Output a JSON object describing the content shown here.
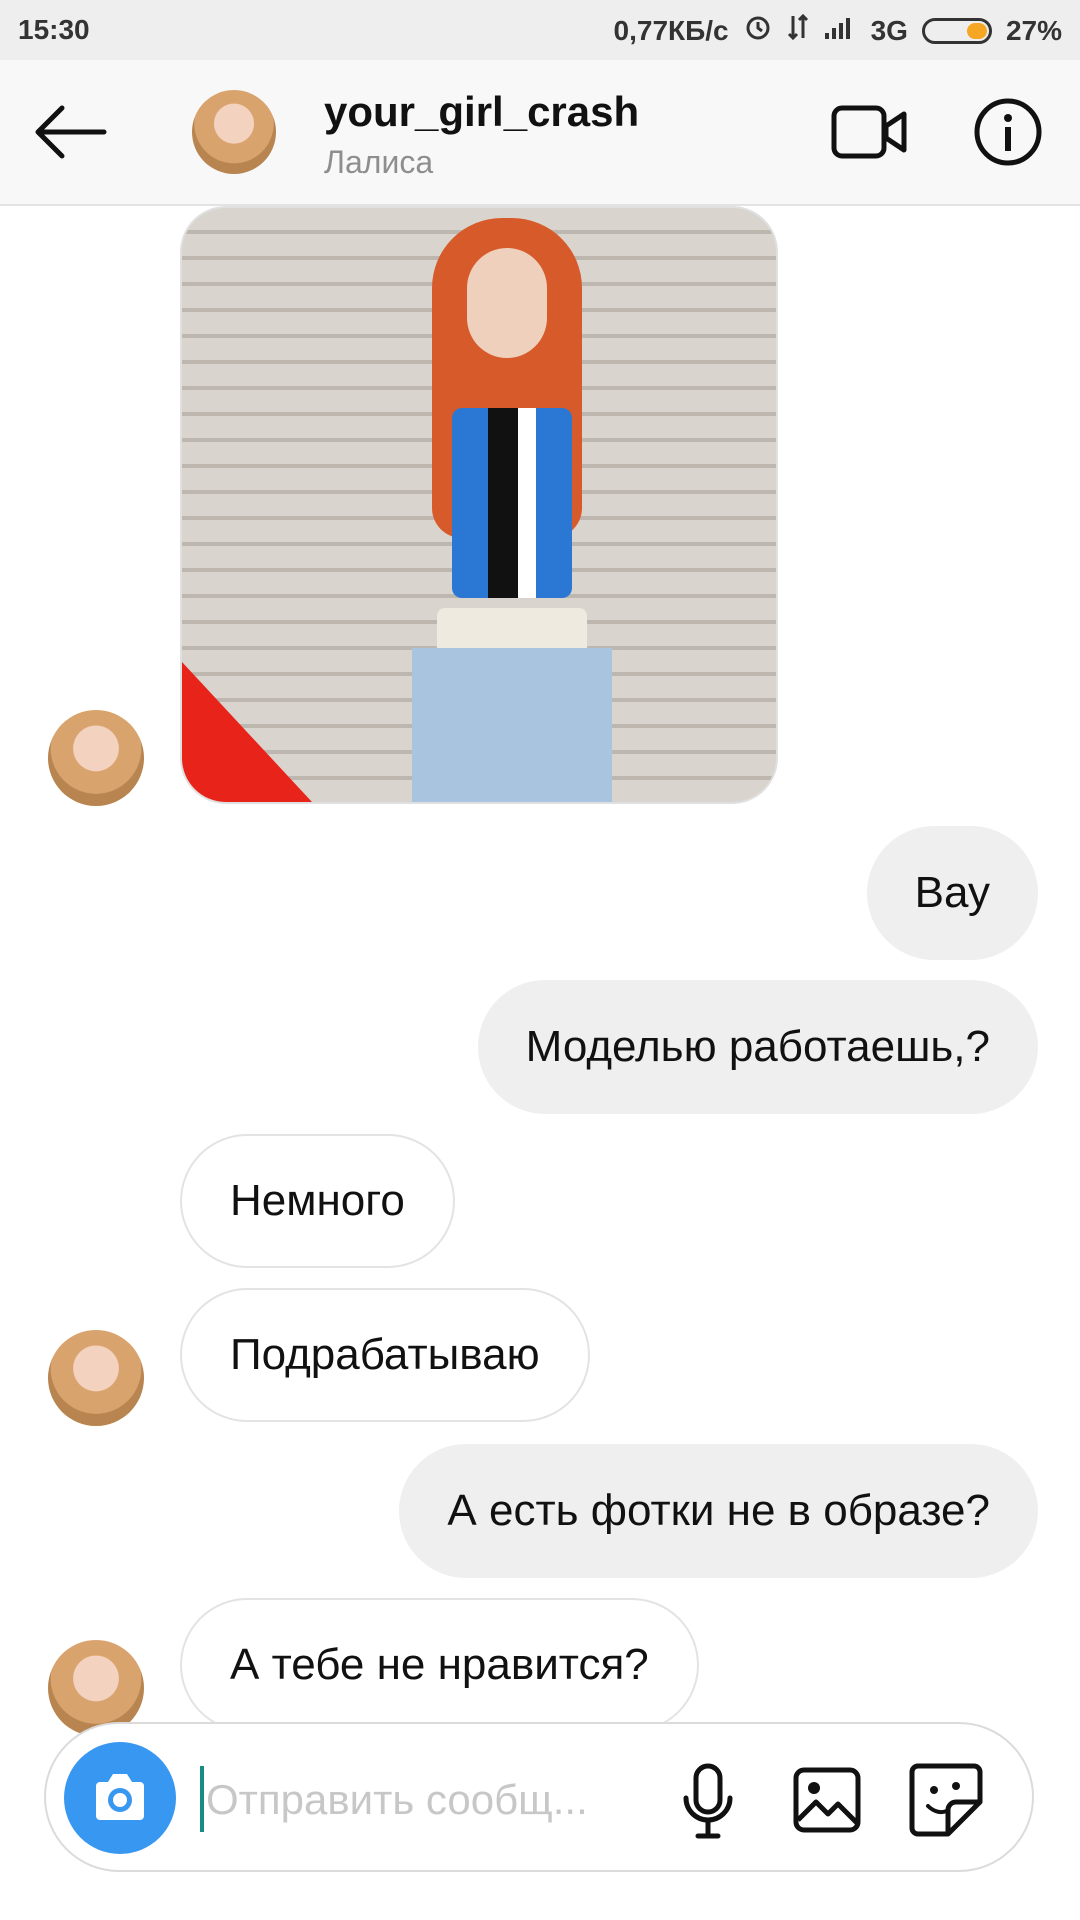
{
  "status_bar": {
    "time": "15:30",
    "speed": "0,77КБ/с",
    "network": "3G",
    "battery": "27%",
    "battery_level": 0.27
  },
  "header": {
    "username": "your_girl_crash",
    "subtitle": "Лалиса",
    "icons": [
      "back-arrow-icon",
      "video-camera-icon",
      "info-icon"
    ]
  },
  "messages": [
    {
      "from": "them",
      "type": "photo"
    },
    {
      "from": "me",
      "text": "Вау"
    },
    {
      "from": "me",
      "text": "Моделью работаешь,?"
    },
    {
      "from": "them",
      "text": "Немного"
    },
    {
      "from": "them",
      "text": "Подрабатываю"
    },
    {
      "from": "me",
      "text": "А есть фотки не в образе?"
    },
    {
      "from": "them",
      "text": "А тебе не нравится?"
    }
  ],
  "composer": {
    "placeholder": "Отправить сообщ...",
    "accent": "#3897f0",
    "icons": [
      "camera-icon",
      "microphone-icon",
      "gallery-icon",
      "sticker-icon"
    ]
  }
}
